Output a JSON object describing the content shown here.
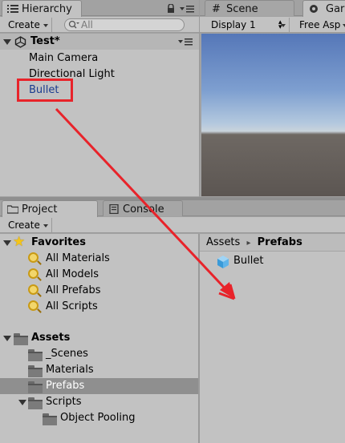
{
  "hierarchy": {
    "tab_label": "Hierarchy",
    "create_label": "Create",
    "search_placeholder": "All",
    "scene_name": "Test*",
    "items": [
      {
        "label": "Main Camera"
      },
      {
        "label": "Directional Light"
      },
      {
        "label": "Bullet"
      }
    ]
  },
  "scene_tabs": {
    "scene_label": "Scene",
    "game_label": "Gar",
    "display_label": "Display 1",
    "aspect_label": "Free Asp"
  },
  "project": {
    "tab_label": "Project",
    "console_tab_label": "Console",
    "create_label": "Create",
    "favorites_label": "Favorites",
    "favorites": [
      {
        "label": "All Materials"
      },
      {
        "label": "All Models"
      },
      {
        "label": "All Prefabs"
      },
      {
        "label": "All Scripts"
      }
    ],
    "assets_label": "Assets",
    "folders": [
      {
        "label": "_Scenes"
      },
      {
        "label": "Materials"
      },
      {
        "label": "Prefabs"
      },
      {
        "label": "Scripts"
      },
      {
        "label": "Object Pooling"
      }
    ],
    "breadcrumb": {
      "root": "Assets",
      "separator": "▸",
      "current": "Prefabs"
    },
    "files": [
      {
        "label": "Bullet"
      }
    ]
  },
  "colors": {
    "panel": "#c2c2c2",
    "selection": "#8f8f8f",
    "annotation_red": "#e8232a",
    "highlight_text": "#1a3c8f"
  }
}
